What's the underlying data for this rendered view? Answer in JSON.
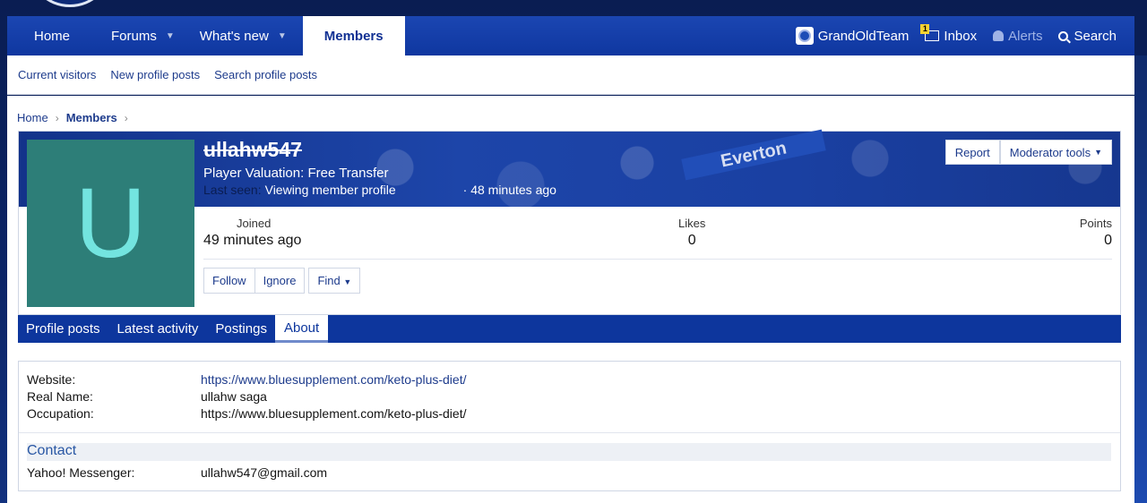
{
  "nav": {
    "tabs": [
      "Home",
      "Forums",
      "What's new",
      "Members"
    ],
    "user": "GrandOldTeam",
    "inbox": "Inbox",
    "inbox_badge": "1",
    "alerts": "Alerts",
    "search": "Search"
  },
  "subnav": [
    "Current visitors",
    "New profile posts",
    "Search profile posts"
  ],
  "breadcrumb": [
    "Home",
    "Members"
  ],
  "profile": {
    "avatar_letter": "U",
    "username": "ullahw547",
    "valuation": "Player Valuation: Free Transfer",
    "last_seen_label": "Last seen:",
    "last_seen_activity": "Viewing member profile",
    "last_seen_ago": "· 48 minutes ago",
    "banner_text": "Everton",
    "report_label": "Report",
    "moderator_label": "Moderator tools",
    "stats": {
      "joined_label": "Joined",
      "joined_value": "49 minutes ago",
      "likes_label": "Likes",
      "likes_value": "0",
      "points_label": "Points",
      "points_value": "0"
    },
    "follow_label": "Follow",
    "ignore_label": "Ignore",
    "find_label": "Find"
  },
  "tabs": [
    "Profile posts",
    "Latest activity",
    "Postings",
    "About"
  ],
  "about": {
    "website_label": "Website:",
    "website_value": "https://www.bluesupplement.com/keto-plus-diet/",
    "realname_label": "Real Name:",
    "realname_value": "ullahw saga",
    "occupation_label": "Occupation:",
    "occupation_value": "https://www.bluesupplement.com/keto-plus-diet/",
    "contact_heading": "Contact",
    "yahoo_label": "Yahoo! Messenger:",
    "yahoo_value": "ullahw547@gmail.com"
  }
}
